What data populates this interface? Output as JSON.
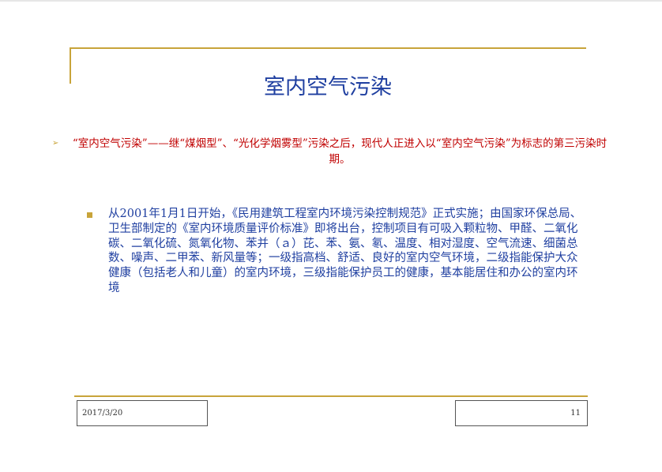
{
  "slide": {
    "title": "室内空气污染",
    "bullets": [
      {
        "marker": "➢",
        "text": "“室内空气污染”——继“煤烟型”、“光化学烟雾型”污染之后，现代人正进入以“室内空气污染”为标志的第三污染时期。"
      },
      {
        "marker": "■",
        "text": "从2001年1月1日开始，《民用建筑工程室内环境污染控制规范》正式实施；由国家环保总局、卫生部制定的《室内环境质量评价标准》即将出台，控制项目有可吸入颗粒物、甲醛、二氧化碳、二氧化硫、氮氧化物、苯并（ａ）芘、苯、氨、氡、温度、相对湿度、空气流速、细菌总数、噪声、二甲苯、新风量等；一级指高档、舒适、良好的室内空气环境，二级指能保护大众健康（包括老人和儿童）的室内环境，三级指能保护员工的健康，基本能居住和办公的室内环境"
      }
    ]
  },
  "footer": {
    "date": "2017/3/20",
    "page_number": "11"
  },
  "colors": {
    "accent_gold": "#c8a43a",
    "title_blue": "#1f3fa0",
    "highlight_red": "#c00000"
  }
}
